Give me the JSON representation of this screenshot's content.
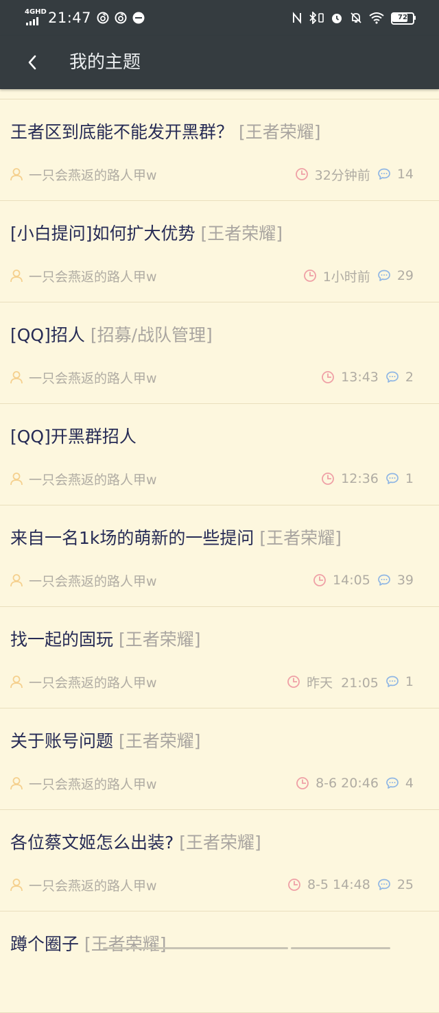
{
  "status_bar": {
    "network": "4GHD",
    "time": "21:47",
    "battery": "72",
    "left_icons": [
      "netease-music-icon",
      "netease-music-icon",
      "jovi-icon"
    ],
    "right_icons": [
      "nfc-icon",
      "bluetooth-icon",
      "vibrate-icon",
      "alarm-icon",
      "mute-icon",
      "wifi-icon"
    ]
  },
  "app_bar": {
    "title": "我的主题"
  },
  "topics": [
    {
      "title": "王者区到底能不能发开黑群？",
      "board": "[王者荣耀]",
      "author": "一只会燕返的路人甲w",
      "time": "32分钟前",
      "replies": "14"
    },
    {
      "title": "[小白提问]如何扩大优势",
      "board": "[王者荣耀]",
      "author": "一只会燕返的路人甲w",
      "time": "1小时前",
      "replies": "29"
    },
    {
      "title": "[QQ]招人",
      "board": "[招募/战队管理]",
      "author": "一只会燕返的路人甲w",
      "time": "13:43",
      "replies": "2"
    },
    {
      "title": "[QQ]开黑群招人",
      "board": "",
      "author": "一只会燕返的路人甲w",
      "time": "12:36",
      "replies": "1"
    },
    {
      "title": "来自一名1k场的萌新的一些提问",
      "board": "[王者荣耀]",
      "author": "一只会燕返的路人甲w",
      "time": "14:05",
      "replies": "39"
    },
    {
      "title": "找一起的固玩",
      "board": "[王者荣耀]",
      "author": "一只会燕返的路人甲w",
      "time": "昨天  21:05",
      "replies": "1"
    },
    {
      "title": "关于账号问题",
      "board": "[王者荣耀]",
      "author": "一只会燕返的路人甲w",
      "time": "8-6 20:46",
      "replies": "4"
    },
    {
      "title": "各位蔡文姬怎么出装?",
      "board": "[王者荣耀]",
      "author": "一只会燕返的路人甲w",
      "time": "8-5 14:48",
      "replies": "25"
    },
    {
      "title": "蹲个圈子",
      "board": "[王者荣耀]",
      "author": "",
      "time": "",
      "replies": ""
    }
  ],
  "colors": {
    "app_bar": "#353c40",
    "background": "#fdf7de",
    "title_text": "#262b55",
    "board_tag": "#a9a5a0",
    "meta_text": "#b0aca3",
    "user_icon": "#f5d08e",
    "clock_icon": "#efa0a6",
    "chat_icon": "#8fb6e4"
  }
}
